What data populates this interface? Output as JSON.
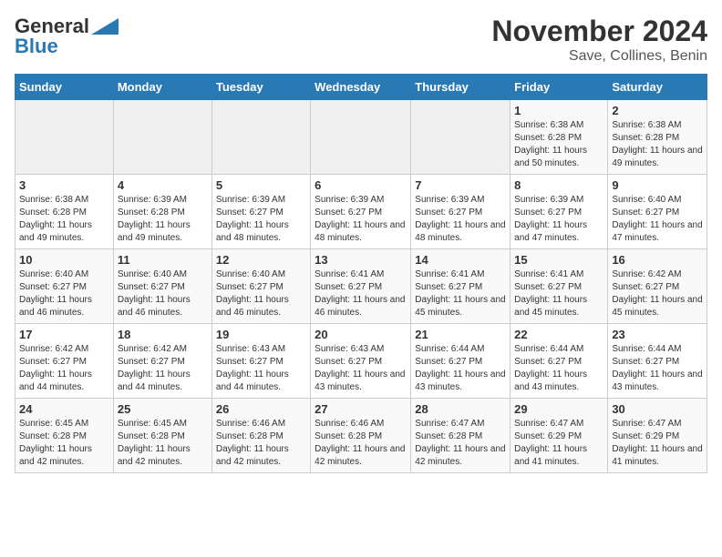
{
  "logo": {
    "line1": "General",
    "line2": "Blue"
  },
  "title": "November 2024",
  "subtitle": "Save, Collines, Benin",
  "weekdays": [
    "Sunday",
    "Monday",
    "Tuesday",
    "Wednesday",
    "Thursday",
    "Friday",
    "Saturday"
  ],
  "weeks": [
    [
      {
        "day": "",
        "info": ""
      },
      {
        "day": "",
        "info": ""
      },
      {
        "day": "",
        "info": ""
      },
      {
        "day": "",
        "info": ""
      },
      {
        "day": "",
        "info": ""
      },
      {
        "day": "1",
        "info": "Sunrise: 6:38 AM\nSunset: 6:28 PM\nDaylight: 11 hours and 50 minutes."
      },
      {
        "day": "2",
        "info": "Sunrise: 6:38 AM\nSunset: 6:28 PM\nDaylight: 11 hours and 49 minutes."
      }
    ],
    [
      {
        "day": "3",
        "info": "Sunrise: 6:38 AM\nSunset: 6:28 PM\nDaylight: 11 hours and 49 minutes."
      },
      {
        "day": "4",
        "info": "Sunrise: 6:39 AM\nSunset: 6:28 PM\nDaylight: 11 hours and 49 minutes."
      },
      {
        "day": "5",
        "info": "Sunrise: 6:39 AM\nSunset: 6:27 PM\nDaylight: 11 hours and 48 minutes."
      },
      {
        "day": "6",
        "info": "Sunrise: 6:39 AM\nSunset: 6:27 PM\nDaylight: 11 hours and 48 minutes."
      },
      {
        "day": "7",
        "info": "Sunrise: 6:39 AM\nSunset: 6:27 PM\nDaylight: 11 hours and 48 minutes."
      },
      {
        "day": "8",
        "info": "Sunrise: 6:39 AM\nSunset: 6:27 PM\nDaylight: 11 hours and 47 minutes."
      },
      {
        "day": "9",
        "info": "Sunrise: 6:40 AM\nSunset: 6:27 PM\nDaylight: 11 hours and 47 minutes."
      }
    ],
    [
      {
        "day": "10",
        "info": "Sunrise: 6:40 AM\nSunset: 6:27 PM\nDaylight: 11 hours and 46 minutes."
      },
      {
        "day": "11",
        "info": "Sunrise: 6:40 AM\nSunset: 6:27 PM\nDaylight: 11 hours and 46 minutes."
      },
      {
        "day": "12",
        "info": "Sunrise: 6:40 AM\nSunset: 6:27 PM\nDaylight: 11 hours and 46 minutes."
      },
      {
        "day": "13",
        "info": "Sunrise: 6:41 AM\nSunset: 6:27 PM\nDaylight: 11 hours and 46 minutes."
      },
      {
        "day": "14",
        "info": "Sunrise: 6:41 AM\nSunset: 6:27 PM\nDaylight: 11 hours and 45 minutes."
      },
      {
        "day": "15",
        "info": "Sunrise: 6:41 AM\nSunset: 6:27 PM\nDaylight: 11 hours and 45 minutes."
      },
      {
        "day": "16",
        "info": "Sunrise: 6:42 AM\nSunset: 6:27 PM\nDaylight: 11 hours and 45 minutes."
      }
    ],
    [
      {
        "day": "17",
        "info": "Sunrise: 6:42 AM\nSunset: 6:27 PM\nDaylight: 11 hours and 44 minutes."
      },
      {
        "day": "18",
        "info": "Sunrise: 6:42 AM\nSunset: 6:27 PM\nDaylight: 11 hours and 44 minutes."
      },
      {
        "day": "19",
        "info": "Sunrise: 6:43 AM\nSunset: 6:27 PM\nDaylight: 11 hours and 44 minutes."
      },
      {
        "day": "20",
        "info": "Sunrise: 6:43 AM\nSunset: 6:27 PM\nDaylight: 11 hours and 43 minutes."
      },
      {
        "day": "21",
        "info": "Sunrise: 6:44 AM\nSunset: 6:27 PM\nDaylight: 11 hours and 43 minutes."
      },
      {
        "day": "22",
        "info": "Sunrise: 6:44 AM\nSunset: 6:27 PM\nDaylight: 11 hours and 43 minutes."
      },
      {
        "day": "23",
        "info": "Sunrise: 6:44 AM\nSunset: 6:27 PM\nDaylight: 11 hours and 43 minutes."
      }
    ],
    [
      {
        "day": "24",
        "info": "Sunrise: 6:45 AM\nSunset: 6:28 PM\nDaylight: 11 hours and 42 minutes."
      },
      {
        "day": "25",
        "info": "Sunrise: 6:45 AM\nSunset: 6:28 PM\nDaylight: 11 hours and 42 minutes."
      },
      {
        "day": "26",
        "info": "Sunrise: 6:46 AM\nSunset: 6:28 PM\nDaylight: 11 hours and 42 minutes."
      },
      {
        "day": "27",
        "info": "Sunrise: 6:46 AM\nSunset: 6:28 PM\nDaylight: 11 hours and 42 minutes."
      },
      {
        "day": "28",
        "info": "Sunrise: 6:47 AM\nSunset: 6:28 PM\nDaylight: 11 hours and 42 minutes."
      },
      {
        "day": "29",
        "info": "Sunrise: 6:47 AM\nSunset: 6:29 PM\nDaylight: 11 hours and 41 minutes."
      },
      {
        "day": "30",
        "info": "Sunrise: 6:47 AM\nSunset: 6:29 PM\nDaylight: 11 hours and 41 minutes."
      }
    ]
  ]
}
